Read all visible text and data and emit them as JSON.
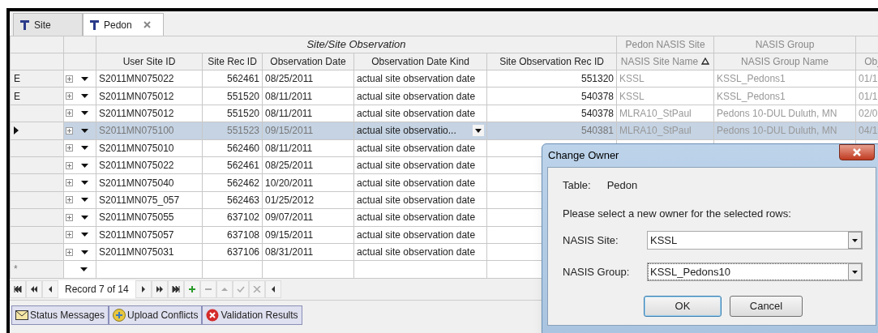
{
  "tabs": [
    {
      "label": "Site",
      "selected": false,
      "closable": false
    },
    {
      "label": "Pedon",
      "selected": true,
      "closable": true
    }
  ],
  "grid": {
    "group_headers": [
      {
        "label": "Site/Site Observation",
        "readonly": false
      },
      {
        "label": "Pedon NASIS Site",
        "readonly": true
      },
      {
        "label": "NASIS Group",
        "readonly": true
      }
    ],
    "columns": [
      {
        "label": "User Site ID",
        "readonly": false,
        "sorted": false
      },
      {
        "label": "Site Rec ID",
        "readonly": false,
        "sorted": false
      },
      {
        "label": "Observation Date",
        "readonly": false,
        "sorted": false
      },
      {
        "label": "Observation Date Kind",
        "readonly": false,
        "sorted": false
      },
      {
        "label": "Site Observation Rec ID",
        "readonly": false,
        "sorted": false
      },
      {
        "label": "NASIS Site Name",
        "readonly": true,
        "sorted": true
      },
      {
        "label": "NASIS Group Name",
        "readonly": true,
        "sorted": false
      },
      {
        "label": "Obj",
        "readonly": true,
        "sorted": false
      }
    ],
    "rows": [
      {
        "marker": "E",
        "selected": false,
        "cells": [
          "S2011MN075022",
          "562461",
          "08/25/2011",
          "actual site observation date",
          "551320",
          "KSSL",
          "KSSL_Pedons1",
          "01/1"
        ]
      },
      {
        "marker": "E",
        "selected": false,
        "cells": [
          "S2011MN075012",
          "551520",
          "08/11/2011",
          "actual site observation date",
          "540378",
          "KSSL",
          "KSSL_Pedons1",
          "01/1"
        ]
      },
      {
        "selected": false,
        "cells": [
          "S2011MN075012",
          "551520",
          "08/11/2011",
          "actual site observation date",
          "540378",
          "MLRA10_StPaul",
          "Pedons 10-DUL Duluth, MN",
          "02/0"
        ]
      },
      {
        "selected": true,
        "cells": [
          "S2011MN075100",
          "551523",
          "09/15/2011",
          "actual site observatio...",
          "540381",
          "MLRA10_StPaul",
          "Pedons 10-DUL Duluth, MN",
          "04/1"
        ]
      },
      {
        "selected": false,
        "cells": [
          "S2011MN075010",
          "562460",
          "08/11/2011",
          "actual site observation date"
        ]
      },
      {
        "selected": false,
        "cells": [
          "S2011MN075022",
          "562461",
          "08/25/2011",
          "actual site observation date"
        ]
      },
      {
        "selected": false,
        "cells": [
          "S2011MN075040",
          "562462",
          "10/20/2011",
          "actual site observation date"
        ]
      },
      {
        "selected": false,
        "cells": [
          "S2011MN075_057",
          "562463",
          "01/25/2012",
          "actual site observation date"
        ]
      },
      {
        "selected": false,
        "cells": [
          "S2011MN075055",
          "637102",
          "09/07/2011",
          "actual site observation date"
        ]
      },
      {
        "selected": false,
        "cells": [
          "S2011MN075057",
          "637108",
          "09/15/2011",
          "actual site observation date"
        ]
      },
      {
        "selected": false,
        "cells": [
          "S2011MN075031",
          "637106",
          "08/31/2011",
          "actual site observation date"
        ]
      }
    ],
    "new_row_marker": "*"
  },
  "navigator": {
    "record": "Record 7 of 14"
  },
  "bottom_tabs": [
    {
      "label": "Status Messages",
      "kind": "mail"
    },
    {
      "label": "Upload Conflicts",
      "kind": "conflict"
    },
    {
      "label": "Validation Results",
      "kind": "error"
    }
  ],
  "dialog": {
    "title": "Change Owner",
    "table_label": "Table:",
    "table_value": "Pedon",
    "prompt": "Please select a new owner for the selected rows:",
    "fields": [
      {
        "label": "NASIS Site:",
        "value": "KSSL",
        "focused": false
      },
      {
        "label": "NASIS Group:",
        "value": "KSSL_Pedons10",
        "focused": true
      }
    ],
    "buttons": [
      {
        "label": "OK",
        "default": true
      },
      {
        "label": "Cancel",
        "default": false
      }
    ]
  }
}
